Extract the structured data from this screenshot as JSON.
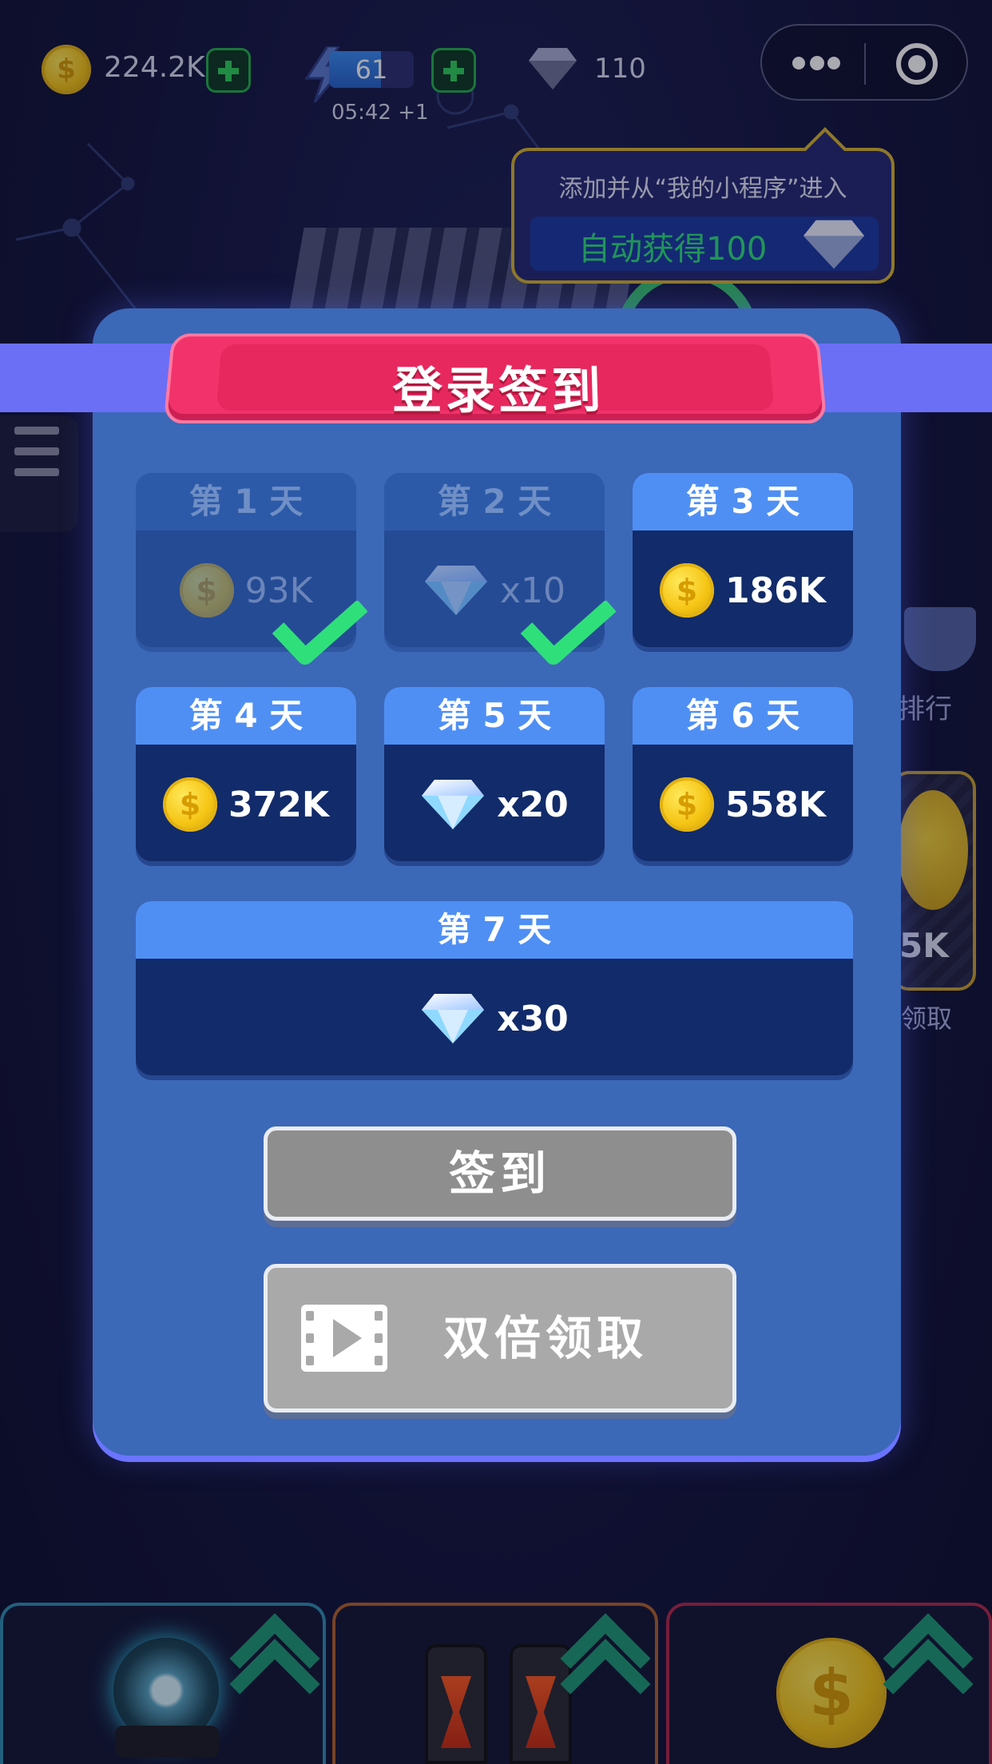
{
  "hud": {
    "coins": "224.2K",
    "energy": "61",
    "energy_level": 0.61,
    "energy_timer": "05:42 +1",
    "gems": "110"
  },
  "tip": {
    "line1": "添加并从“我的小程序”进入",
    "line2": "自动获得100"
  },
  "background": {
    "rank_label": "排行",
    "coin_amount": "5K",
    "claim_label": "领取"
  },
  "modal": {
    "title": "登录签到",
    "days": [
      {
        "label": "第 1 天",
        "reward_type": "coin-icon",
        "amount": "93K",
        "claimed": true
      },
      {
        "label": "第 2 天",
        "reward_type": "gem-icon",
        "amount": "x10",
        "claimed": true
      },
      {
        "label": "第 3 天",
        "reward_type": "coin-icon",
        "amount": "186K",
        "claimed": false
      },
      {
        "label": "第 4 天",
        "reward_type": "coin-icon",
        "amount": "372K",
        "claimed": false
      },
      {
        "label": "第 5 天",
        "reward_type": "gem-icon",
        "amount": "x20",
        "claimed": false
      },
      {
        "label": "第 6 天",
        "reward_type": "coin-icon",
        "amount": "558K",
        "claimed": false
      },
      {
        "label": "第 7 天",
        "reward_type": "gem-icon",
        "amount": "x30",
        "claimed": false
      }
    ],
    "checkin_label": "签到",
    "double_label": "双倍领取"
  },
  "colors": {
    "accent_pink": "#f2326a",
    "card_head_blue": "#4f8ff4",
    "card_body_navy": "#122b6a",
    "check_green": "#2fe07a"
  }
}
